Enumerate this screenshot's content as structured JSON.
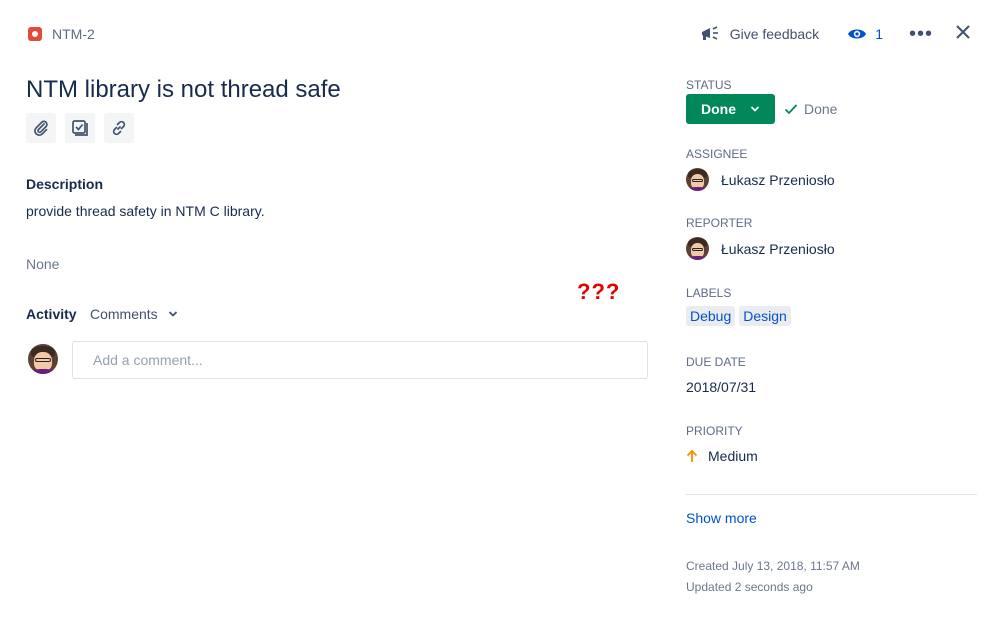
{
  "header": {
    "issue_key": "NTM-2",
    "feedback_label": "Give feedback",
    "watch_count": "1",
    "more_label": "•••"
  },
  "issue": {
    "title": "NTM library is not thread safe",
    "description_label": "Description",
    "description": "provide thread safety in NTM C library.",
    "none_text": "None",
    "annotation": "???"
  },
  "activity": {
    "label": "Activity",
    "filter": "Comments",
    "comment_placeholder": "Add a comment..."
  },
  "sidebar": {
    "status_label": "STATUS",
    "status": "Done",
    "resolution": "Done",
    "assignee_label": "ASSIGNEE",
    "assignee": "Łukasz Przeniosło",
    "reporter_label": "REPORTER",
    "reporter": "Łukasz Przeniosło",
    "labels_label": "LABELS",
    "labels": [
      "Debug",
      "Design"
    ],
    "due_label": "DUE DATE",
    "due_date": "2018/07/31",
    "priority_label": "PRIORITY",
    "priority": "Medium",
    "show_more": "Show more",
    "created": "Created July 13, 2018, 11:57 AM",
    "updated": "Updated 2 seconds ago"
  },
  "colors": {
    "status_green": "#00875a",
    "link_blue": "#0052cc",
    "bug_red": "#e5493a",
    "priority_orange": "#ff8b00",
    "annotation_red": "#e60000"
  },
  "icons": [
    "bug-icon",
    "megaphone-icon",
    "eye-icon",
    "more-icon",
    "close-icon",
    "attachment-icon",
    "subtask-icon",
    "link-icon",
    "chevron-down-icon",
    "check-icon",
    "arrow-up-icon"
  ]
}
